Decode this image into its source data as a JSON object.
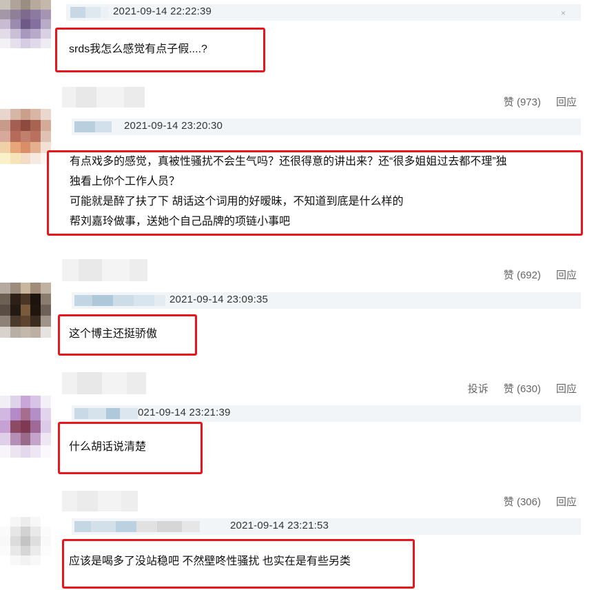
{
  "comments": [
    {
      "timestamp": "2021-09-14 22:22:39",
      "lines": [
        "srds我怎么感觉有点子假....?"
      ],
      "like_label": "",
      "reply_label": ""
    },
    {
      "timestamp": "2021-09-14 23:20:30",
      "lines": [
        "有点戏多的感觉，真被性骚扰不会生气吗？还很得意的讲出来？还“很多姐姐过去都不理”独",
        "独看上你个工作人员？",
        "可能就是醉了扶了下 胡话这个词用的好暧昧，不知道到底是什么样的",
        "帮刘嘉玲做事，送她个自己品牌的项链小事吧"
      ],
      "like_label": "赞 (973)",
      "reply_label": "回应"
    },
    {
      "timestamp": "2021-09-14 23:09:35",
      "lines": [
        "这个博主还挺骄傲"
      ],
      "like_label": "赞 (692)",
      "reply_label": "回应"
    },
    {
      "timestamp": "021-09-14 23:21:39",
      "lines": [
        "什么胡话说清楚"
      ],
      "report_label": "投诉",
      "like_label": "赞 (630)",
      "reply_label": "回应"
    },
    {
      "timestamp": "2021-09-14 23:21:53",
      "lines": [
        "应该是喝多了没站稳吧 不然壁咚性骚扰 也实在是有些另类"
      ],
      "like_label": "赞 (306)",
      "reply_label": "回应"
    }
  ],
  "close_icon": "×",
  "colors": {
    "highlight_border": "#e8161c",
    "meta_bar": "#f1f5f8"
  }
}
